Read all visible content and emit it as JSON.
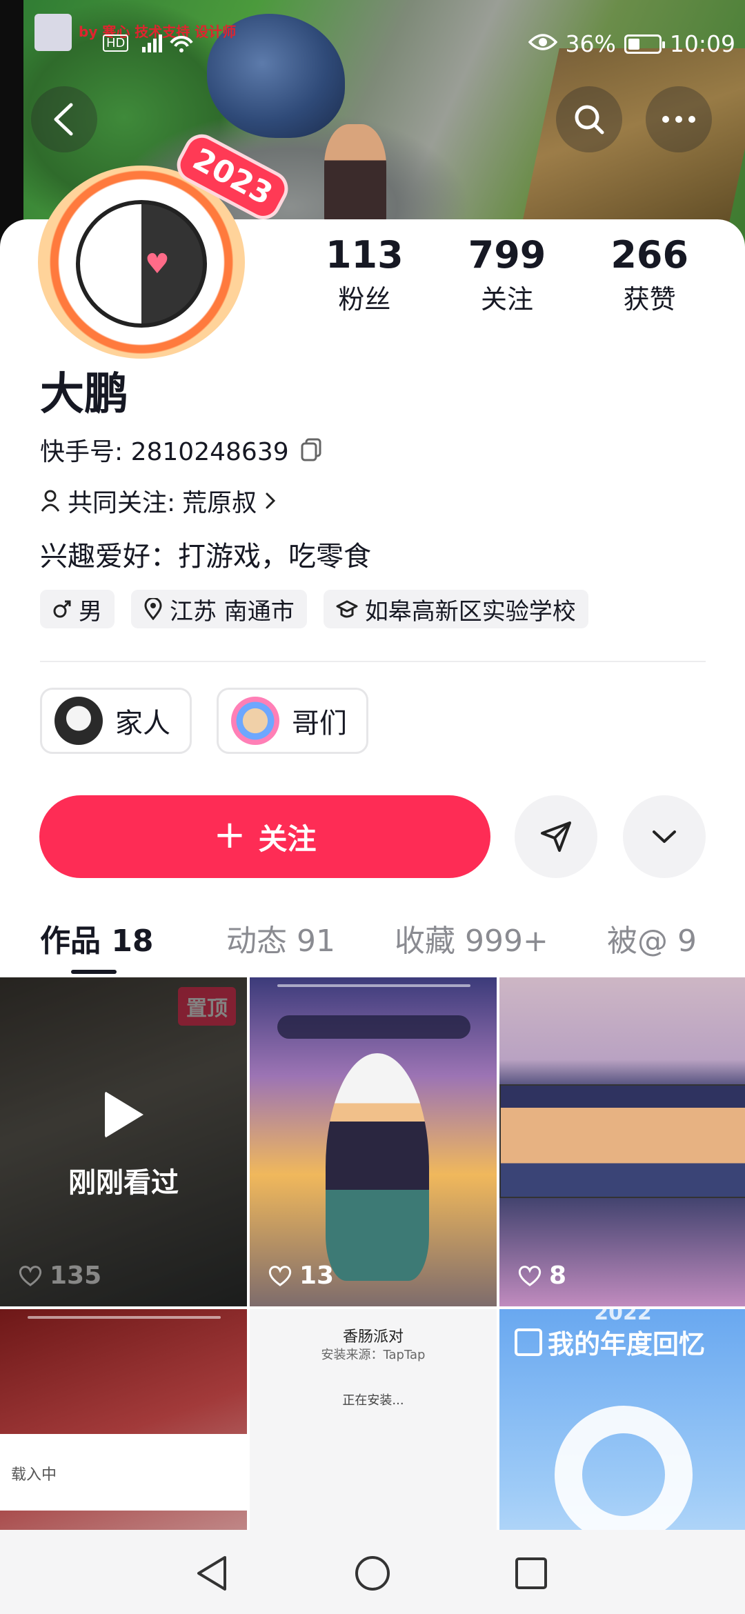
{
  "status_bar": {
    "overlay_text": "by 寒心 技术支持 设计师",
    "hd": "HD",
    "network": "4G",
    "battery_percent": "36%",
    "time": "10:09"
  },
  "profile": {
    "avatar_badge": "2023",
    "name": "大鹏",
    "kuaishou_id_label": "快手号:",
    "kuaishou_id": "2810248639",
    "mutual_label": "共同关注:",
    "mutual_name": "荒原叔",
    "bio": "兴趣爱好：打游戏，吃零食",
    "tags": [
      {
        "icon": "male-icon",
        "text": "男"
      },
      {
        "icon": "location-icon",
        "text": "江苏 南通市"
      },
      {
        "icon": "school-icon",
        "text": "如皋高新区实验学校"
      }
    ]
  },
  "stats": [
    {
      "value": "113",
      "label": "粉丝"
    },
    {
      "value": "799",
      "label": "关注"
    },
    {
      "value": "266",
      "label": "获赞"
    }
  ],
  "groups": [
    {
      "label": "家人"
    },
    {
      "label": "哥们"
    }
  ],
  "actions": {
    "follow_label": "关注"
  },
  "tabs": [
    {
      "label": "作品 18",
      "active": true
    },
    {
      "label": "动态 91",
      "active": false
    },
    {
      "label": "收藏 999+",
      "active": false
    },
    {
      "label": "被@ 9",
      "active": false
    }
  ],
  "grid": {
    "pinned_label": "置顶",
    "watched_label": "刚刚看过",
    "items": [
      {
        "likes": "135"
      },
      {
        "likes": "13"
      },
      {
        "likes": "8"
      }
    ],
    "loading_text": "载入中",
    "install": {
      "app_name": "香肠派对",
      "source": "安装来源：TapTap",
      "status": "正在安装..."
    },
    "memory": {
      "year": "2022",
      "title": "我的年度回忆"
    }
  },
  "colors": {
    "accent": "#fe2c55",
    "text_primary": "#161823",
    "text_secondary": "#8a8b91",
    "chip_bg": "#f2f2f4"
  }
}
